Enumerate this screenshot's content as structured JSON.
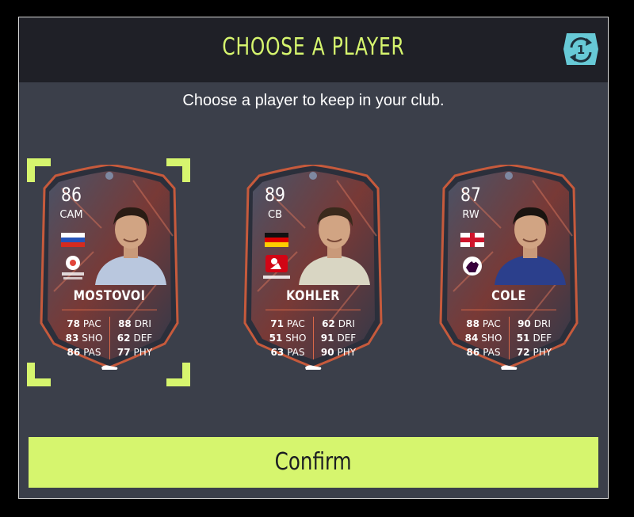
{
  "dialog": {
    "title": "CHOOSE A PLAYER",
    "subtitle": "Choose a player to keep in your club.",
    "refresh_count": "1",
    "confirm_label": "Confirm"
  },
  "colors": {
    "accent": "#d6f56e",
    "card_border": "#d96848",
    "panel": "#3b3f4a",
    "header": "#1f2027"
  },
  "cards": [
    {
      "rating": "86",
      "position": "CAM",
      "name": "MOSTOVOI",
      "flag": "russia",
      "league": "laliga",
      "league_text": "LaLiga Santander",
      "selected": true,
      "stats": [
        {
          "v": "78",
          "k": "PAC"
        },
        {
          "v": "83",
          "k": "SHO"
        },
        {
          "v": "86",
          "k": "PAS"
        },
        {
          "v": "88",
          "k": "DRI"
        },
        {
          "v": "62",
          "k": "DEF"
        },
        {
          "v": "77",
          "k": "PHY"
        }
      ]
    },
    {
      "rating": "89",
      "position": "CB",
      "name": "KOHLER",
      "flag": "germany",
      "league": "bundesliga",
      "league_text": "BUNDESLIGA",
      "selected": false,
      "stats": [
        {
          "v": "71",
          "k": "PAC"
        },
        {
          "v": "51",
          "k": "SHO"
        },
        {
          "v": "63",
          "k": "PAS"
        },
        {
          "v": "62",
          "k": "DRI"
        },
        {
          "v": "91",
          "k": "DEF"
        },
        {
          "v": "90",
          "k": "PHY"
        }
      ]
    },
    {
      "rating": "87",
      "position": "RW",
      "name": "COLE",
      "flag": "england",
      "league": "premier-league",
      "league_text": "",
      "selected": false,
      "stats": [
        {
          "v": "88",
          "k": "PAC"
        },
        {
          "v": "84",
          "k": "SHO"
        },
        {
          "v": "86",
          "k": "PAS"
        },
        {
          "v": "90",
          "k": "DRI"
        },
        {
          "v": "51",
          "k": "DEF"
        },
        {
          "v": "72",
          "k": "PHY"
        }
      ]
    }
  ]
}
